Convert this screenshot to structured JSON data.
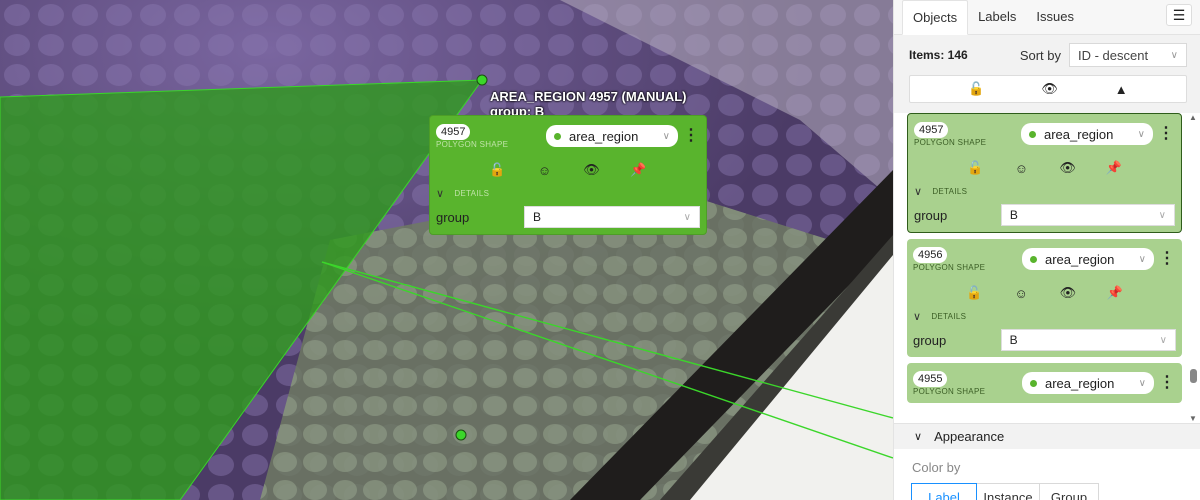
{
  "canvas": {
    "caption_title": "AREA_REGION 4957 (MANUAL)",
    "caption_sub": "group: B"
  },
  "popup": {
    "id": "4957",
    "shape": "POLYGON SHAPE",
    "label": "area_region",
    "details": "DETAILS",
    "attr_name": "group",
    "attr_value": "B"
  },
  "sidebar": {
    "tabs": [
      {
        "label": "Objects"
      },
      {
        "label": "Labels"
      },
      {
        "label": "Issues"
      }
    ],
    "items_count": "Items: 146",
    "sort_by_label": "Sort by",
    "sort_value": "ID - descent",
    "objects": [
      {
        "id": "4957",
        "shape": "POLYGON SHAPE",
        "label": "area_region",
        "details": "DETAILS",
        "attr_name": "group",
        "attr_value": "B"
      },
      {
        "id": "4956",
        "shape": "POLYGON SHAPE",
        "label": "area_region",
        "details": "DETAILS",
        "attr_name": "group",
        "attr_value": "B"
      },
      {
        "id": "4955",
        "shape": "POLYGON SHAPE",
        "label": "area_region"
      }
    ],
    "appearance": {
      "title": "Appearance",
      "color_by": "Color by",
      "options": [
        {
          "label": "Label"
        },
        {
          "label": "Instance"
        },
        {
          "label": "Group"
        }
      ],
      "selected": "Label"
    }
  },
  "colors": {
    "shape_fill": "#2f9a1f",
    "active_card": "#59b42d",
    "card": "#a9d18e",
    "accent": "#1890ff"
  }
}
